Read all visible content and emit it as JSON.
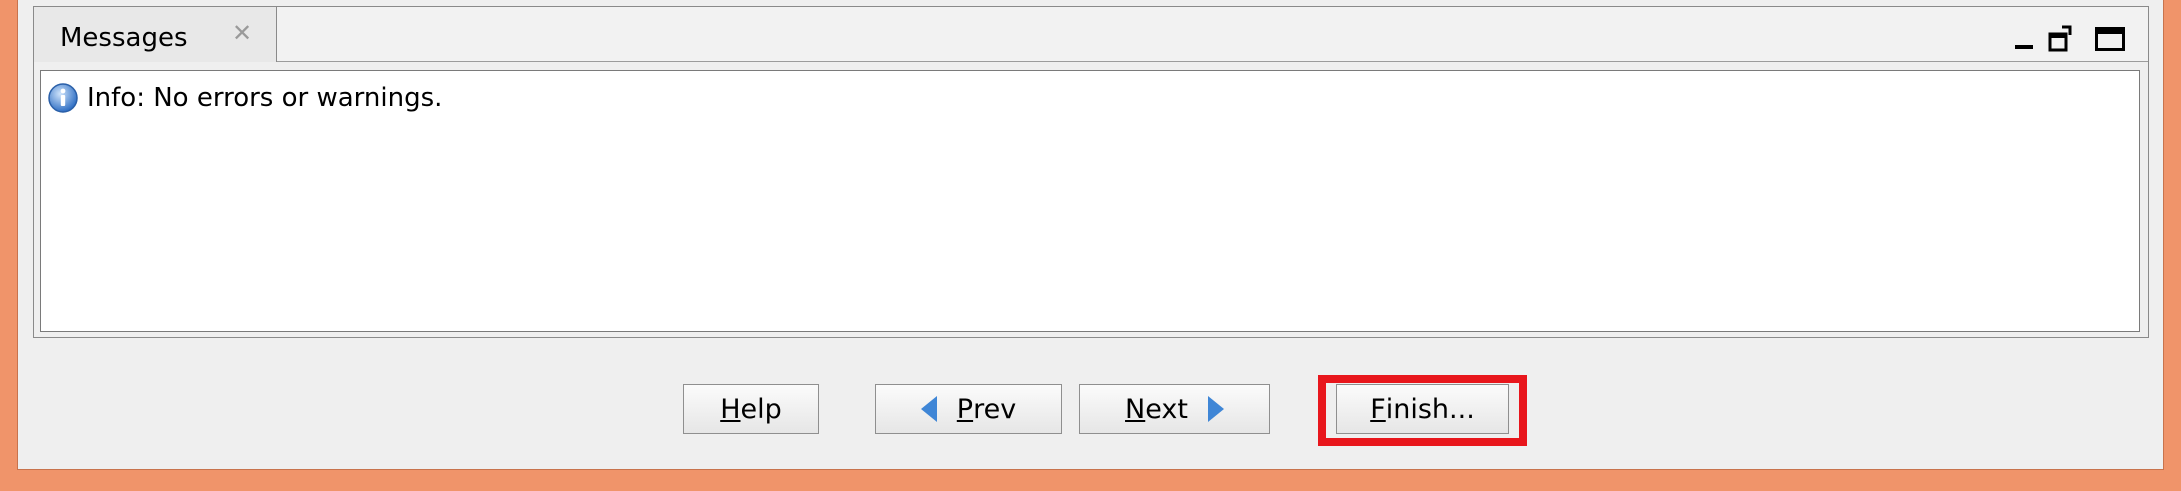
{
  "messages_panel": {
    "tab_label": "Messages",
    "tab_close_glyph": "✕",
    "message_icon": "info-icon",
    "message_text": "Info: No errors or warnings."
  },
  "buttons": {
    "help": {
      "mnemonic": "H",
      "rest": "elp"
    },
    "prev": {
      "mnemonic": "P",
      "rest": "rev"
    },
    "next": {
      "mnemonic": "N",
      "rest": "ext"
    },
    "finish": {
      "mnemonic": "F",
      "rest": "inish..."
    }
  },
  "colors": {
    "window_border": "#f0946a",
    "highlight": "#e8161c",
    "arrow": "#3f86d6"
  }
}
